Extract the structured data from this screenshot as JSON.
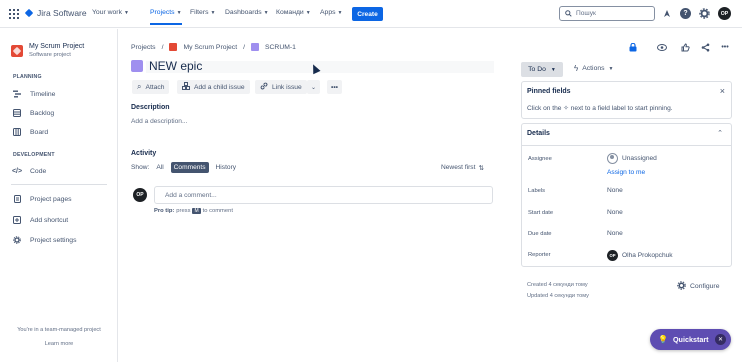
{
  "topnav": {
    "app_name": "Jira Software",
    "items": [
      {
        "label": "Your work"
      },
      {
        "label": "Projects"
      },
      {
        "label": "Filters"
      },
      {
        "label": "Dashboards"
      },
      {
        "label": "Команди"
      },
      {
        "label": "Apps"
      }
    ],
    "create_label": "Create",
    "search_placeholder": "Пошук",
    "avatar_initials": "OP",
    "help_glyph": "?",
    "accent": "#0c66e4"
  },
  "sidebar": {
    "project_name": "My Scrum Project",
    "project_type": "Software project",
    "planning_title": "PLANNING",
    "planning_items": [
      "Timeline",
      "Backlog",
      "Board"
    ],
    "development_title": "DEVELOPMENT",
    "development_items": [
      "Code"
    ],
    "extra_items": [
      "Project pages",
      "Add shortcut",
      "Project settings"
    ],
    "team_note": "You're in a team-managed project",
    "learn_more": "Learn more"
  },
  "issue": {
    "breadcrumb": [
      "Projects",
      "My Scrum Project",
      "SCRUM-1"
    ],
    "title": "NEW epic",
    "actions": [
      "Attach",
      "Add a child issue",
      "Link issue"
    ],
    "description_label": "Description",
    "description_placeholder": "Add a description...",
    "activity_label": "Activity",
    "show_label": "Show:",
    "filters": [
      "All",
      "Comments",
      "History"
    ],
    "selected_filter": "Comments",
    "sort_label": "Newest first",
    "comment_placeholder": "Add a comment...",
    "protip_label": "Pro tip:",
    "protip_press": "press",
    "protip_key": "M",
    "protip_text": "to comment",
    "commenter_initials": "OP"
  },
  "panel": {
    "status": "To Do",
    "actions_label": "Actions",
    "pinned_title": "Pinned fields",
    "pinned_help_before": "Click on the",
    "pinned_help_after": "next to a field label to start pinning.",
    "details_title": "Details",
    "fields": {
      "assignee_label": "Assignee",
      "assignee_value": "Unassigned",
      "assign_to_me": "Assign to me",
      "labels_label": "Labels",
      "labels_value": "None",
      "start_date_label": "Start date",
      "start_date_value": "None",
      "due_date_label": "Due date",
      "due_date_value": "None",
      "reporter_label": "Reporter",
      "reporter_initials": "OP",
      "reporter_value": "Olha Prokopchuk"
    },
    "created": "Created 4 секунди тому",
    "updated": "Updated 4 секунди тому",
    "configure_label": "Configure"
  },
  "quickstart": {
    "label": "Quickstart"
  }
}
